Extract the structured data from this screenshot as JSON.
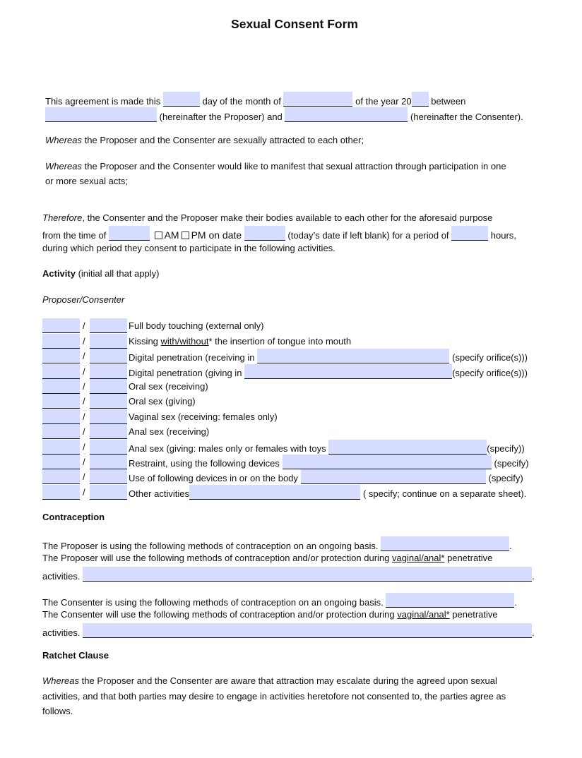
{
  "title": "Sexual Consent Form",
  "intro": {
    "t1": "This agreement is made this",
    "t2": "day of the month of",
    "t3": "of the year 20",
    "t4": "between",
    "t5": "(hereinafter the Proposer) and",
    "t6": "(hereinafter the Consenter).",
    "fields": {
      "day": "",
      "month": "",
      "year": "",
      "proposer": "",
      "consenter": ""
    }
  },
  "whereas1": {
    "lead": "Whereas",
    "text": " the Proposer and the Consenter are sexually attracted to each other;"
  },
  "whereas2": {
    "lead": "Whereas",
    "line1": " the Proposer and the Consenter would like to manifest that sexual attraction through participation in one",
    "line2": "or more sexual acts;"
  },
  "therefore": {
    "lead": "Therefore",
    "line1": ", the Consenter and the Proposer make their bodies available to each other for the aforesaid purpose",
    "from": "from the time of",
    "am": "AM",
    "pm": "PM on date",
    "todays": "(today’s date if left blank) for a period of",
    "hours": "hours,",
    "line3": "during which period they consent to participate in the following activities.",
    "fields": {
      "time": "",
      "date": "",
      "hours": ""
    },
    "am_checked": false,
    "pm_checked": false
  },
  "activity_heading": {
    "bold": "Activity",
    "rest": " (initial all that apply)"
  },
  "columns_label": "Proposer/Consenter",
  "activities": [
    {
      "label": "Full body touching (external only)"
    },
    {
      "label_pre": "Kissing ",
      "label_u": "with/without",
      "label_post": "* the insertion of tongue into mouth"
    },
    {
      "label": "Digital penetration (receiving in",
      "suffix": "(specify orifice(s)))"
    },
    {
      "label": "Digital penetration (giving in",
      "suffix": "(specify orifice(s)))"
    },
    {
      "label": "Oral sex (receiving)"
    },
    {
      "label": "Oral sex (giving)"
    },
    {
      "label": "Vaginal sex (receiving: females only)"
    },
    {
      "label": "Anal sex (receiving)"
    },
    {
      "label": "Anal sex (giving: males only or females with toys",
      "suffix": "(specify))"
    },
    {
      "label": "Restraint, using the following devices",
      "suffix": "(specify)"
    },
    {
      "label": "Use of following devices in or on the body",
      "suffix": "(specify)"
    },
    {
      "label": "Other activities",
      "suffix": "( specify; continue on a separate sheet)."
    }
  ],
  "separator": "/",
  "contraception": {
    "heading": "Contraception",
    "proposer_ongoing": "The Proposer is using the following methods of contraception on an ongoing basis.",
    "proposer_will_pre": "The Proposer will use the following methods of contraception and/or protection during ",
    "consenter_ongoing": "The Consenter is using the following methods of contraception on an ongoing basis.",
    "consenter_will_pre": "The Consenter will use the following methods of contraception and/or protection during ",
    "will_u": "vaginal/anal*",
    "will_post": " penetrative",
    "activities": "activities.",
    "period": "."
  },
  "ratchet": {
    "heading": "Ratchet Clause",
    "lead": "Whereas",
    "line1": " the Proposer and the Consenter are aware that attraction may escalate during the agreed upon sexual",
    "line2": "activities, and that both parties may desire to engage in activities heretofore not consented to, the parties agree as",
    "line3": "follows."
  },
  "colors": {
    "field_fill": "#d6dcff",
    "text": "#111111"
  }
}
